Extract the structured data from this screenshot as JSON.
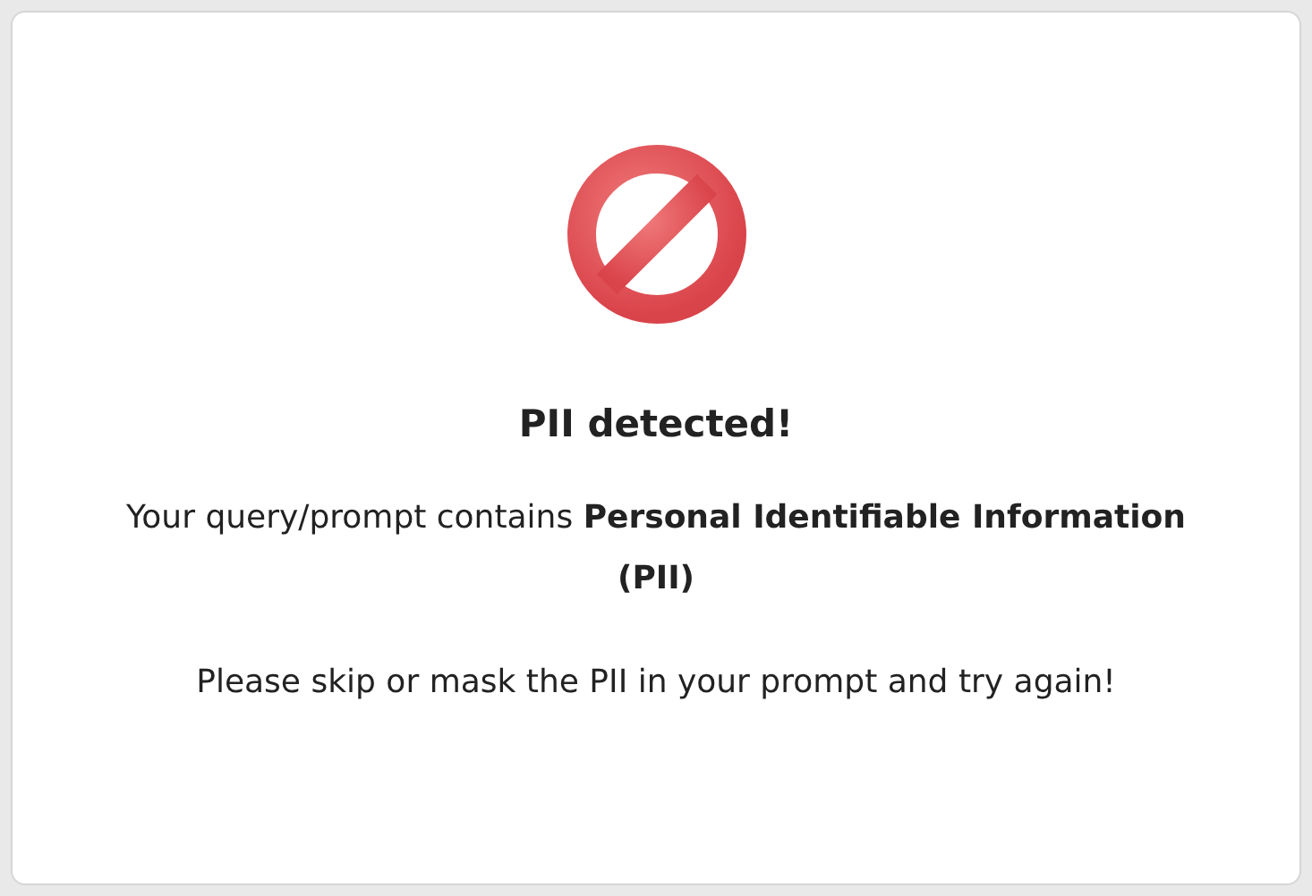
{
  "dialog": {
    "title": "PII detected!",
    "message": "Your query/prompt contains **Personal Identifiable Information (PII)**",
    "instruction": "Please skip or mask the PII in your prompt and try again!"
  }
}
